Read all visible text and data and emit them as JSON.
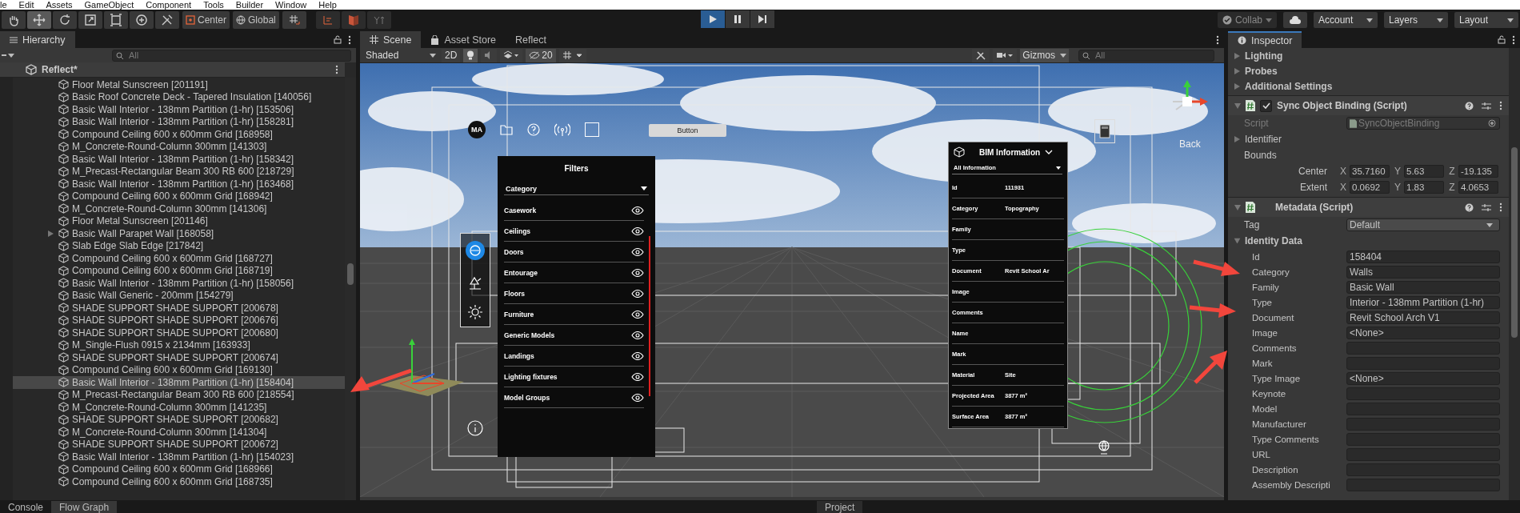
{
  "menu": [
    "le",
    "Edit",
    "Assets",
    "GameObject",
    "Component",
    "Tools",
    "Builder",
    "Window",
    "Help"
  ],
  "toolbar": {
    "tools": [
      {
        "kind": "hand",
        "selected": false
      },
      {
        "kind": "move",
        "selected": true
      },
      {
        "kind": "rotate",
        "selected": false
      },
      {
        "kind": "scale",
        "selected": false
      },
      {
        "kind": "rect",
        "selected": false
      },
      {
        "kind": "transform",
        "selected": false
      },
      {
        "kind": "custom",
        "selected": false
      }
    ],
    "pivot": "Center",
    "space": "Global",
    "play": [
      {
        "kind": "play",
        "selected": true
      },
      {
        "kind": "pause",
        "selected": false
      },
      {
        "kind": "step",
        "selected": false
      }
    ],
    "collab": "Collab",
    "account": "Account",
    "layers": "Layers",
    "layout": "Layout"
  },
  "hierarchy": {
    "tab": "Hierarchy",
    "search": {
      "placeholder": "All"
    },
    "scene": "Reflect*",
    "items": [
      {
        "label": "Floor Metal Sunscreen [201191]",
        "selected": false,
        "has_children": false
      },
      {
        "label": "Basic Roof Concrete Deck - Tapered Insulation [140056]",
        "selected": false,
        "has_children": false
      },
      {
        "label": "Basic Wall Interior - 138mm Partition (1-hr) [153506]",
        "selected": false,
        "has_children": false
      },
      {
        "label": "Basic Wall Interior - 138mm Partition (1-hr) [158281]",
        "selected": false,
        "has_children": false
      },
      {
        "label": "Compound Ceiling 600 x 600mm Grid [168958]",
        "selected": false,
        "has_children": false
      },
      {
        "label": "M_Concrete-Round-Column 300mm [141303]",
        "selected": false,
        "has_children": false
      },
      {
        "label": "Basic Wall Interior - 138mm Partition (1-hr) [158342]",
        "selected": false,
        "has_children": false
      },
      {
        "label": "M_Precast-Rectangular Beam 300 RB 600 [218729]",
        "selected": false,
        "has_children": false
      },
      {
        "label": "Basic Wall Interior - 138mm Partition (1-hr) [163468]",
        "selected": false,
        "has_children": false
      },
      {
        "label": "Compound Ceiling 600 x 600mm Grid [168942]",
        "selected": false,
        "has_children": false
      },
      {
        "label": "M_Concrete-Round-Column 300mm [141306]",
        "selected": false,
        "has_children": false
      },
      {
        "label": "Floor Metal Sunscreen [201146]",
        "selected": false,
        "has_children": false
      },
      {
        "label": "Basic Wall Parapet Wall [168058]",
        "selected": false,
        "has_children": true
      },
      {
        "label": "Slab Edge Slab Edge [217842]",
        "selected": false,
        "has_children": false
      },
      {
        "label": "Compound Ceiling 600 x 600mm Grid [168727]",
        "selected": false,
        "has_children": false
      },
      {
        "label": "Compound Ceiling 600 x 600mm Grid [168719]",
        "selected": false,
        "has_children": false
      },
      {
        "label": "Basic Wall Interior - 138mm Partition (1-hr) [158056]",
        "selected": false,
        "has_children": false
      },
      {
        "label": "Basic Wall Generic - 200mm [154279]",
        "selected": false,
        "has_children": false
      },
      {
        "label": "SHADE SUPPORT SHADE SUPPORT [200678]",
        "selected": false,
        "has_children": false
      },
      {
        "label": "SHADE SUPPORT SHADE SUPPORT [200676]",
        "selected": false,
        "has_children": false
      },
      {
        "label": "SHADE SUPPORT SHADE SUPPORT [200680]",
        "selected": false,
        "has_children": false
      },
      {
        "label": "M_Single-Flush 0915 x 2134mm [163933]",
        "selected": false,
        "has_children": false
      },
      {
        "label": "SHADE SUPPORT SHADE SUPPORT [200674]",
        "selected": false,
        "has_children": false
      },
      {
        "label": "Compound Ceiling 600 x 600mm Grid [169130]",
        "selected": false,
        "has_children": false
      },
      {
        "label": "Basic Wall Interior - 138mm Partition (1-hr) [158404]",
        "selected": true,
        "has_children": false
      },
      {
        "label": "M_Precast-Rectangular Beam 300 RB 600 [218554]",
        "selected": false,
        "has_children": false
      },
      {
        "label": "M_Concrete-Round-Column 300mm [141235]",
        "selected": false,
        "has_children": false
      },
      {
        "label": "SHADE SUPPORT SHADE SUPPORT [200682]",
        "selected": false,
        "has_children": false
      },
      {
        "label": "M_Concrete-Round-Column 300mm [141304]",
        "selected": false,
        "has_children": false
      },
      {
        "label": "SHADE SUPPORT SHADE SUPPORT [200672]",
        "selected": false,
        "has_children": false
      },
      {
        "label": "Basic Wall Interior - 138mm Partition (1-hr) [154023]",
        "selected": false,
        "has_children": false
      },
      {
        "label": "Compound Ceiling 600 x 600mm Grid [168966]",
        "selected": false,
        "has_children": false
      },
      {
        "label": "Compound Ceiling 600 x 600mm Grid [168735]",
        "selected": false,
        "has_children": false
      }
    ]
  },
  "scene": {
    "tabs": [
      {
        "label": "Scene",
        "selected": true,
        "kind": "scene"
      },
      {
        "label": "Asset Store",
        "selected": false,
        "kind": "store"
      },
      {
        "label": "Reflect",
        "selected": false,
        "kind": "plain"
      }
    ],
    "shading": "Shaded",
    "mode_2d": "2D",
    "hidden_count": "20",
    "gizmos": "Gizmos",
    "search": {
      "placeholder": "All"
    },
    "overlay": {
      "avatar": "MA",
      "button": "Button",
      "gizmo_label": "Back",
      "filters": {
        "title": "Filters",
        "dropdown": "Category",
        "items": [
          "Casework",
          "Ceilings",
          "Doors",
          "Entourage",
          "Floors",
          "Furniture",
          "Generic Models",
          "Landings",
          "Lighting fixtures",
          "Model Groups"
        ]
      },
      "bim": {
        "title": "BIM Information",
        "dropdown": "All Information",
        "rows": [
          {
            "label": "Id",
            "value": "111931"
          },
          {
            "label": "Category",
            "value": "Topography"
          },
          {
            "label": "Family"
          },
          {
            "label": "Type"
          },
          {
            "label": "Document",
            "value": "Revit School Ar"
          },
          {
            "label": "Image"
          },
          {
            "label": "Comments"
          },
          {
            "label": "Name"
          },
          {
            "label": "Mark"
          },
          {
            "label": "Material",
            "value": "Site"
          },
          {
            "label": "Projected Area",
            "value": "3877 m²"
          },
          {
            "label": "Surface Area",
            "value": "3877 m²"
          }
        ]
      }
    }
  },
  "inspector": {
    "tab": "Inspector",
    "foldouts": [
      "Lighting",
      "Probes",
      "Additional Settings"
    ],
    "sync": {
      "title": "Sync Object Binding (Script)",
      "enabled": true,
      "script_label": "Script",
      "script": "SyncObjectBinding",
      "identifier": "Identifier",
      "bounds": "Bounds",
      "vectors": [
        {
          "label": "Center",
          "components": [
            {
              "axis": "X",
              "value": "35.7160"
            },
            {
              "axis": "Y",
              "value": "5.63"
            },
            {
              "axis": "Z",
              "value": "-19.135"
            }
          ]
        },
        {
          "label": "Extent",
          "components": [
            {
              "axis": "X",
              "value": "0.0692"
            },
            {
              "axis": "Y",
              "value": "1.83"
            },
            {
              "axis": "Z",
              "value": "4.0653"
            }
          ]
        }
      ]
    },
    "metadata": {
      "title": "Metadata (Script)",
      "tag_label": "Tag",
      "tag": "Default",
      "group": "Identity Data",
      "expanded": true,
      "fields": [
        {
          "label": "Id",
          "value": "158404"
        },
        {
          "label": "Category",
          "value": "Walls"
        },
        {
          "label": "Family",
          "value": "Basic Wall"
        },
        {
          "label": "Type",
          "value": "Interior - 138mm Partition (1-hr)"
        },
        {
          "label": "Document",
          "value": "Revit School Arch V1"
        },
        {
          "label": "Image",
          "value": "<None>"
        },
        {
          "label": "Comments"
        },
        {
          "label": "Mark"
        },
        {
          "label": "Type Image",
          "value": "<None>"
        },
        {
          "label": "Keynote"
        },
        {
          "label": "Model"
        },
        {
          "label": "Manufacturer"
        },
        {
          "label": "Type Comments"
        },
        {
          "label": "URL"
        },
        {
          "label": "Description"
        },
        {
          "label": "Assembly Descripti"
        }
      ]
    }
  },
  "bottom": {
    "tabs": [
      {
        "label": "Console",
        "selected": false
      },
      {
        "label": "Flow Graph",
        "selected": true
      }
    ],
    "project": "Project"
  }
}
